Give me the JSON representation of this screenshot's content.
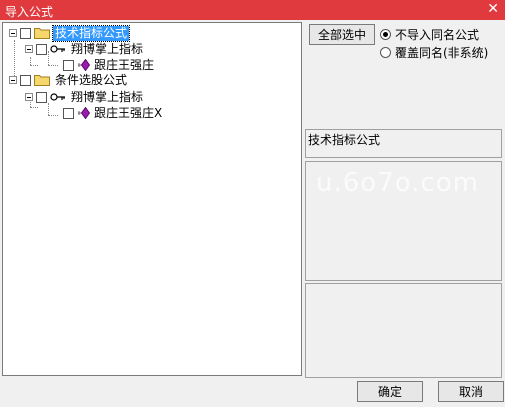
{
  "window": {
    "title": "导入公式",
    "close_glyph": "✕"
  },
  "tree": {
    "groups": [
      {
        "label": "技术指标公式",
        "selected": true,
        "children": [
          {
            "label": "翔博掌上指标",
            "children": [
              {
                "label": "跟庄王强庄"
              }
            ]
          }
        ]
      },
      {
        "label": "条件选股公式",
        "selected": false,
        "children": [
          {
            "label": "翔博掌上指标",
            "children": [
              {
                "label": "跟庄王强庄X"
              }
            ]
          }
        ]
      }
    ]
  },
  "options": {
    "select_all_label": "全部选中",
    "radios": [
      {
        "label": "不导入同名公式",
        "checked": true
      },
      {
        "label": "覆盖同名(非系统)",
        "checked": false
      }
    ]
  },
  "info": {
    "category_name": "技术指标公式"
  },
  "watermark": "u.6o7o.com",
  "buttons": {
    "ok": "确定",
    "cancel": "取消"
  },
  "colors": {
    "titlebar": "#e03a3e",
    "selection": "#3399ff",
    "folder": "#f5d76e",
    "gem": "#9b1bb0"
  }
}
